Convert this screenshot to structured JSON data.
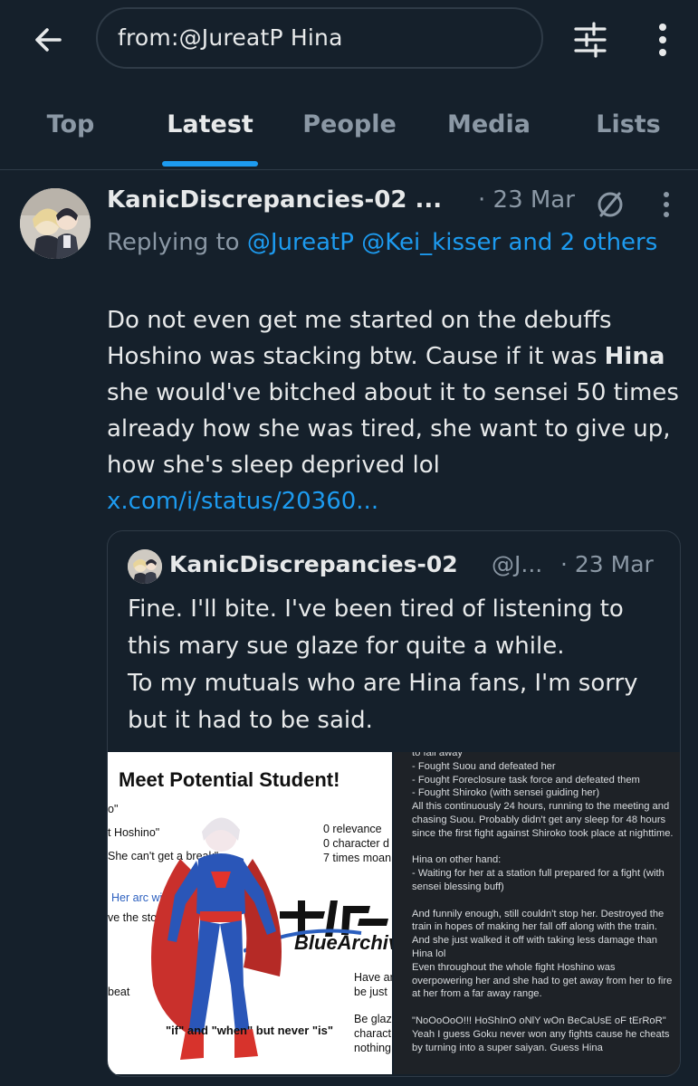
{
  "search": {
    "query": "from:@JureatP Hina"
  },
  "icons": {
    "back": "back-arrow-icon",
    "filter": "filter-sliders-icon",
    "more": "more-vertical-icon"
  },
  "tabs": [
    "Top",
    "Latest",
    "People",
    "Media",
    "Lists"
  ],
  "active_tab": "Latest",
  "colors": {
    "background": "#15202b",
    "accent": "#1d9bf0",
    "muted": "#8b98a5",
    "text": "#e7e9ea"
  },
  "tweet": {
    "author": "KanicDiscrepancies-02 ...",
    "date": "· 23 Mar",
    "replying_prefix": "Replying to ",
    "replying_links": "@JureatP @Kei_kisser and 2 others",
    "text_before": "Do not even get me started on the debuffs Hoshino was stacking btw. Cause if it was ",
    "text_bold": "Hina",
    "text_after": " she would've bitched about it to sensei 50 times already how she was tired, she want to give up, how she's sleep deprived lol ",
    "link": "x.com/i/status/20360..."
  },
  "quote": {
    "author": "KanicDiscrepancies-02",
    "handle": "@J...",
    "date": "· 23 Mar",
    "text": "Fine. I'll bite. I've been tired of listening to this mary sue glaze for quite a while.\nTo my mutuals who are Hina fans, I'm sorry but it had to be said.",
    "image_left": {
      "title": "Meet Potential Student!",
      "lines": [
        "o\"",
        "t Hoshino\"",
        "She can't get a break\"",
        "Her arc will go crazy\"",
        "ve the story\"",
        "0 relevance",
        "0 character d",
        "7 times moan",
        "BlueArchive",
        "Have ar",
        "be just",
        "beat",
        "Be glaz",
        "charact",
        "nothing",
        "\"if\" and \"when\" but never \"is\""
      ]
    },
    "image_right_text": "to fall away\n- Fought Suou and defeated her\n- Fought Foreclosure task force and defeated them\n- Fought Shiroko (with sensei guiding her)\nAll this continuously 24 hours, running to the meeting and chasing Suou. Probably didn't get any sleep for 48 hours since the first fight against Shiroko took place at nighttime.\n\nHina on other hand:\n- Waiting for her at a station full prepared for a fight (with sensei blessing buff)\n\nAnd funnily enough, still couldn't stop her. Destroyed the train in hopes of making her fall off along with the train. And she just walked it off with taking less damage than Hina lol\nEven throughout the whole fight Hoshino was overpowering her and she had to get away from her to fire at her from a far away range.\n\n\"NoOoOoO!!! HoShInO oNlY wOn BeCaUsE oF tErRoR\"\nYeah I guess Goku never won any fights cause he cheats by turning into a super saiyan. Guess Hina"
  }
}
